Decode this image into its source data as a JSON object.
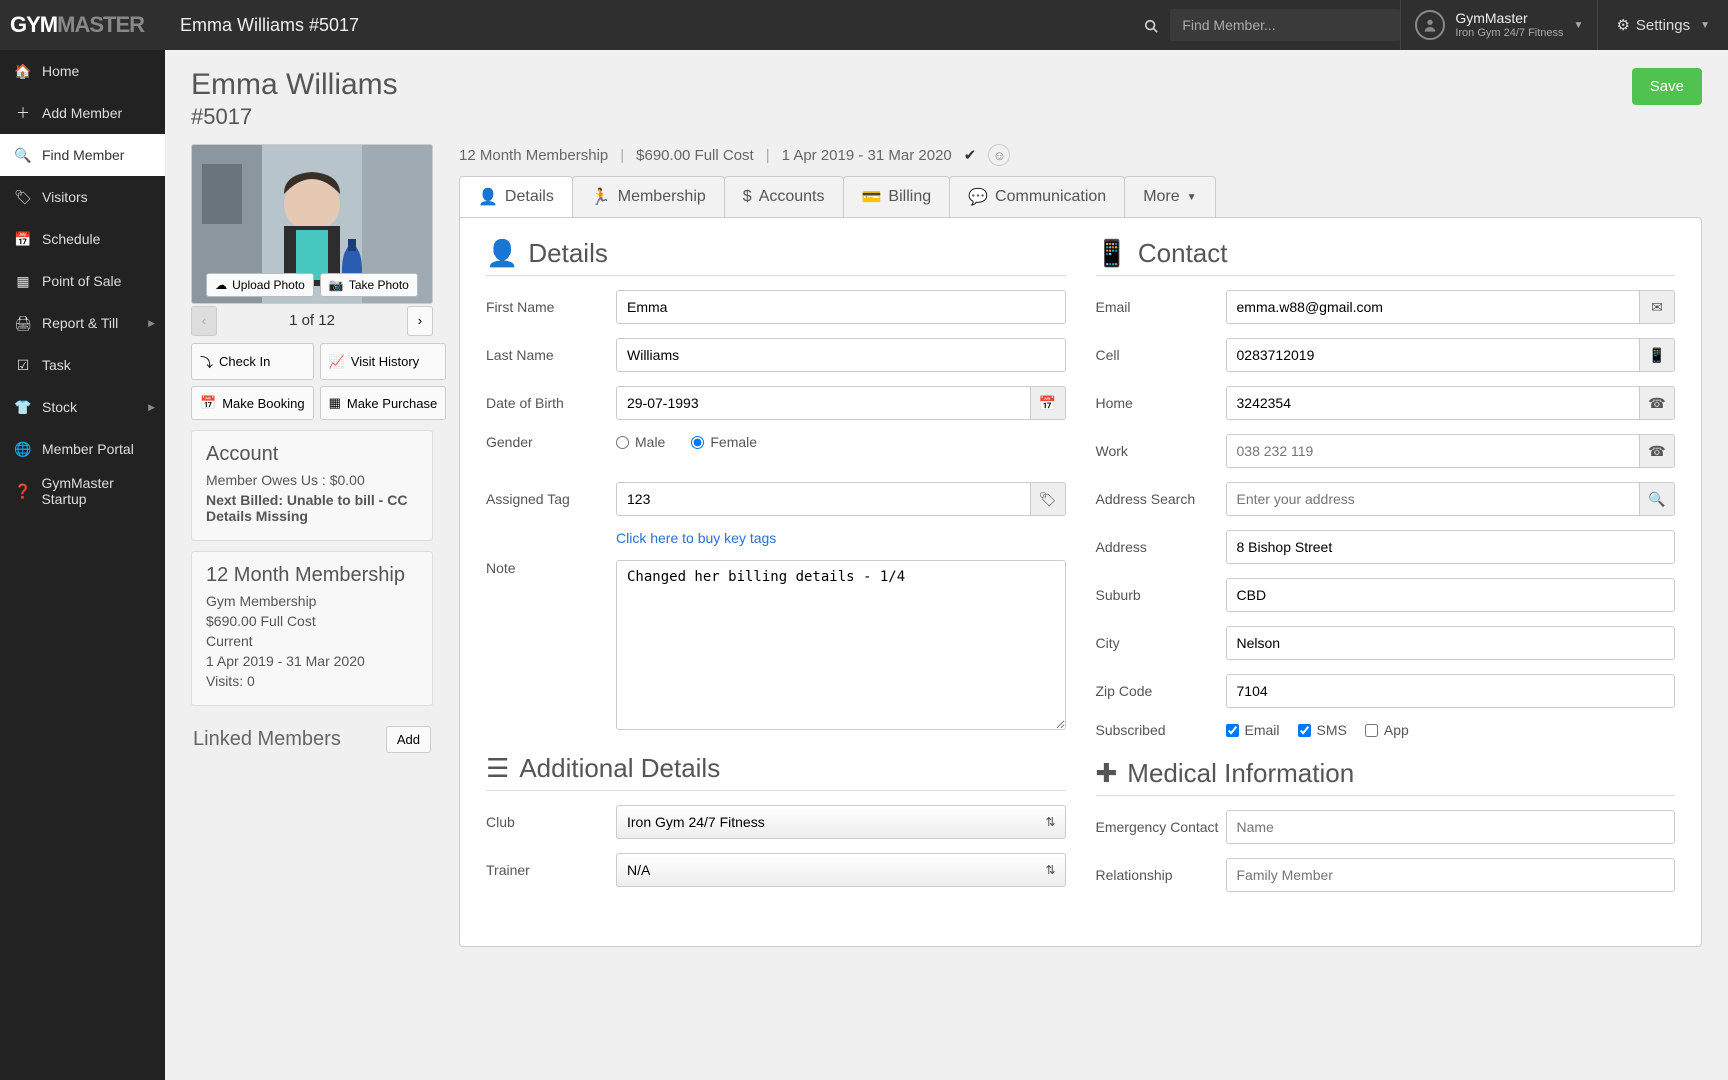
{
  "app": {
    "logo_a": "GYM",
    "logo_b": "MASTER",
    "page_title": "Emma Williams #5017",
    "search_placeholder": "Find Member...",
    "user_name": "GymMaster",
    "user_sub": "Iron Gym 24/7 Fitness",
    "settings_label": "Settings"
  },
  "nav": {
    "home": "Home",
    "add_member": "Add Member",
    "find_member": "Find Member",
    "visitors": "Visitors",
    "schedule": "Schedule",
    "pos": "Point of Sale",
    "report_till": "Report & Till",
    "task": "Task",
    "stock": "Stock",
    "member_portal": "Member Portal",
    "startup": "GymMaster Startup"
  },
  "member": {
    "name": "Emma Williams",
    "number": "#5017",
    "save": "Save"
  },
  "photo": {
    "upload": "Upload Photo",
    "take": "Take Photo",
    "pager": "1 of 12"
  },
  "actions": {
    "checkin": "Check In",
    "visit_history": "Visit History",
    "make_booking": "Make Booking",
    "make_purchase": "Make Purchase"
  },
  "account_card": {
    "title": "Account",
    "owes": "Member Owes Us : $0.00",
    "next_billed": "Next Billed: Unable to bill - CC Details Missing"
  },
  "membership_card": {
    "title": "12 Month Membership",
    "sub": "Gym Membership",
    "cost": "$690.00 Full Cost",
    "status": "Current",
    "period": "1 Apr 2019 - 31 Mar 2020",
    "visits": "Visits: 0"
  },
  "linked": {
    "title": "Linked Members",
    "add": "Add"
  },
  "summary": {
    "plan": "12 Month Membership",
    "cost": "$690.00 Full Cost",
    "period": "1 Apr 2019 - 31 Mar 2020"
  },
  "tabs": {
    "details": "Details",
    "membership": "Membership",
    "accounts": "Accounts",
    "billing": "Billing",
    "communication": "Communication",
    "more": "More"
  },
  "sections": {
    "details": "Details",
    "contact": "Contact",
    "additional": "Additional Details",
    "medical": "Medical Information"
  },
  "details": {
    "first_name_label": "First Name",
    "first_name": "Emma",
    "last_name_label": "Last Name",
    "last_name": "Williams",
    "dob_label": "Date of Birth",
    "dob": "29-07-1993",
    "gender_label": "Gender",
    "gender_male": "Male",
    "gender_female": "Female",
    "assigned_tag_label": "Assigned Tag",
    "assigned_tag": "123",
    "buy_tags": "Click here to buy key tags",
    "note_label": "Note",
    "note": "Changed her billing details - 1/4"
  },
  "contact": {
    "email_label": "Email",
    "email": "emma.w88@gmail.com",
    "cell_label": "Cell",
    "cell": "0283712019",
    "home_label": "Home",
    "home": "3242354",
    "work_label": "Work",
    "work_placeholder": "038 232 119",
    "address_search_label": "Address Search",
    "address_search_placeholder": "Enter your address",
    "address_label": "Address",
    "address": "8 Bishop Street",
    "suburb_label": "Suburb",
    "suburb": "CBD",
    "city_label": "City",
    "city": "Nelson",
    "zip_label": "Zip Code",
    "zip": "7104",
    "subscribed_label": "Subscribed",
    "sub_email": "Email",
    "sub_sms": "SMS",
    "sub_app": "App"
  },
  "additional": {
    "club_label": "Club",
    "club": "Iron Gym 24/7 Fitness",
    "trainer_label": "Trainer",
    "trainer": "N/A"
  },
  "medical": {
    "emergency_label": "Emergency Contact",
    "emergency_placeholder": "Name",
    "relationship_label": "Relationship",
    "relationship_placeholder": "Family Member"
  }
}
